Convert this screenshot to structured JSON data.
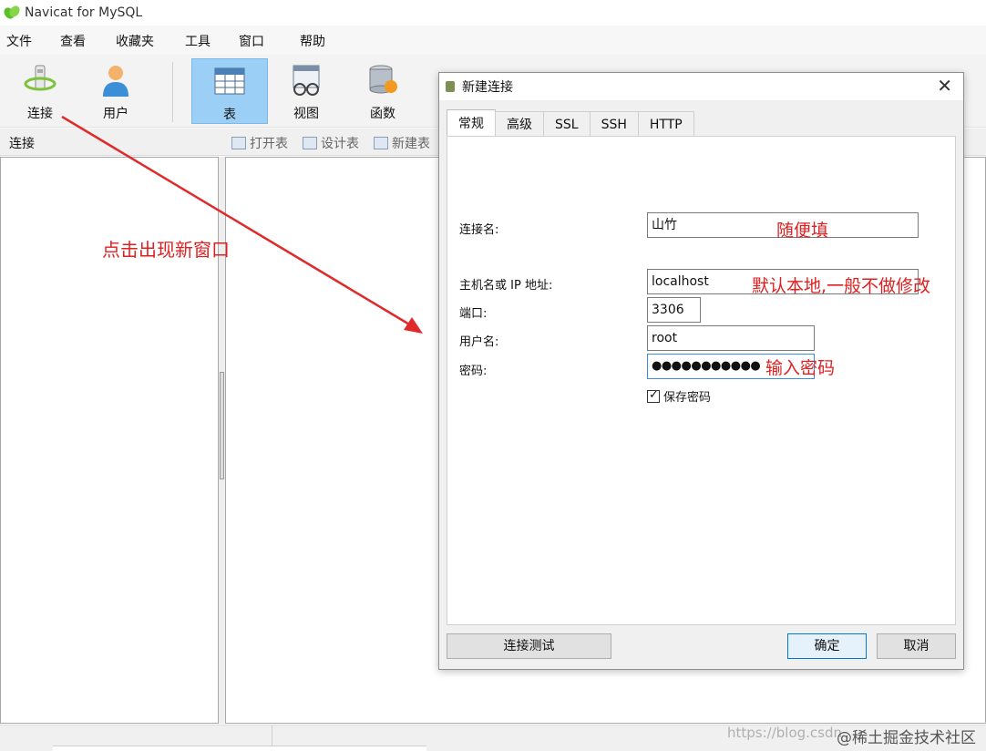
{
  "window": {
    "title": "Navicat for MySQL"
  },
  "menubar": {
    "items": [
      "文件",
      "查看",
      "收藏夹",
      "工具",
      "窗口",
      "帮助"
    ]
  },
  "toolbar": {
    "items": [
      {
        "label": "连接",
        "icon": "connection-icon"
      },
      {
        "label": "用户",
        "icon": "user-icon"
      },
      {
        "label": "表",
        "icon": "table-icon",
        "active": true
      },
      {
        "label": "视图",
        "icon": "view-icon"
      },
      {
        "label": "函数",
        "icon": "function-icon"
      }
    ]
  },
  "subbar": {
    "left_label": "连接",
    "buttons": [
      "打开表",
      "设计表",
      "新建表"
    ]
  },
  "annotation_main": "点击出现新窗口",
  "dialog": {
    "title": "新建连接",
    "tabs": [
      "常规",
      "高级",
      "SSL",
      "SSH",
      "HTTP"
    ],
    "fields": {
      "connection_name": {
        "label": "连接名:",
        "value": "山竹",
        "note": "随便填"
      },
      "host": {
        "label": "主机名或 IP 地址:",
        "value": "localhost",
        "note": "默认本地,一般不做修改"
      },
      "port": {
        "label": "端口:",
        "value": "3306"
      },
      "username": {
        "label": "用户名:",
        "value": "root"
      },
      "password": {
        "label": "密码:",
        "value": "●●●●●●●●●●●",
        "note": "输入密码"
      }
    },
    "save_password": {
      "label": "保存密码",
      "checked": true
    },
    "buttons": {
      "test": "连接测试",
      "ok": "确定",
      "cancel": "取消"
    }
  },
  "watermark": {
    "url": "https://blog.csdn",
    "brand": "@稀土掘金技术社区"
  },
  "colors": {
    "accent": "#9ccff5",
    "annotation": "#e02020",
    "focus": "#3b8be0"
  }
}
